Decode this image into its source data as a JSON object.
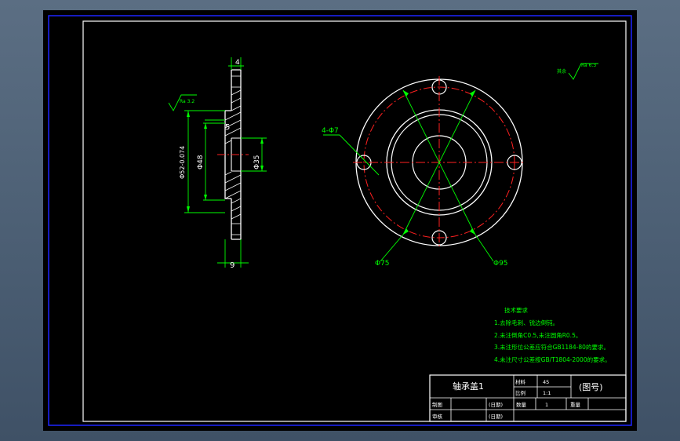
{
  "drawing": {
    "roughness_mark": "Ra 6.3",
    "roughness_rest_prefix": "其余",
    "left_roughness": "Ra 3.2"
  },
  "section_view": {
    "dims": {
      "top_thickness": "4",
      "step": "5",
      "bottom": "9",
      "outer_dia": "Φ52-0.074",
      "bore_dia": "Φ48",
      "inner_dia": "Φ35"
    }
  },
  "plan_view": {
    "holes_label": "4-Φ7",
    "pcd_label": "Φ75",
    "outer_label": "Φ95"
  },
  "notes": {
    "title": "技术要求",
    "items": [
      "1.去除毛刺、锐边倒钝。",
      "2.未注倒角C0.5,未注圆角R0.5。",
      "3.未注形位公差应符合GB1184-80的要求。",
      "4.未注尺寸公差按GB/T1804-2000的要求。"
    ]
  },
  "title_block": {
    "part_name": "轴承盖1",
    "material_label": "材料",
    "material_value": "45",
    "scale_label": "比例",
    "scale_value": "1:1",
    "drawing_no": "(图号)",
    "drawn_label": "制图",
    "checked_label": "审核",
    "date1": "(日期)",
    "date2": "(日期)",
    "qty_label": "数量",
    "qty_value": "1",
    "weight_label": "重量"
  }
}
